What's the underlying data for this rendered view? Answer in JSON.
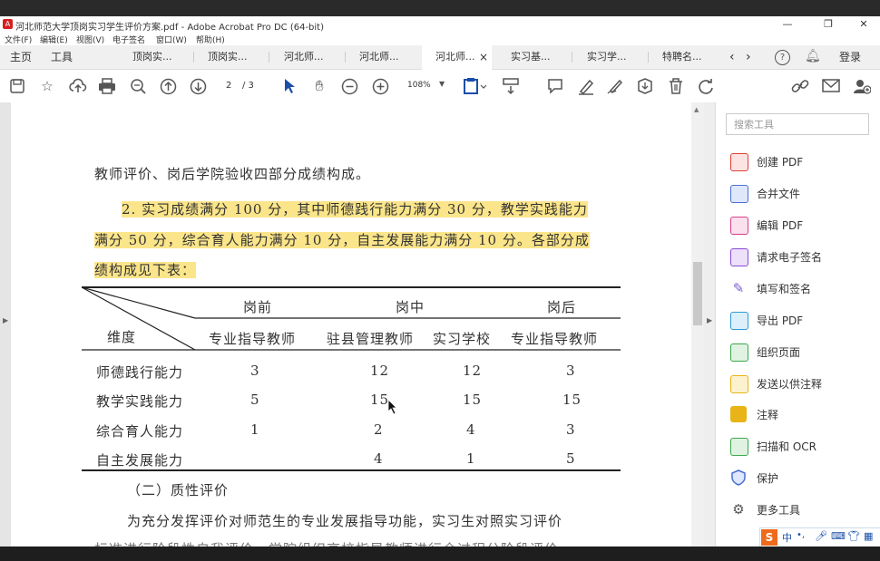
{
  "window": {
    "title": "河北师范大学顶岗实习学生评价方案.pdf - Adobe Acrobat Pro DC (64-bit)",
    "minimize": "—",
    "maximize": "❐",
    "close": "✕"
  },
  "menu": [
    "文件(F)",
    "编辑(E)",
    "视图(V)",
    "电子签名",
    "窗口(W)",
    "帮助(H)"
  ],
  "tabs": {
    "home": "主页",
    "tools": "工具",
    "items": [
      "顶岗实...",
      "顶岗实...",
      "河北师...",
      "河北师...",
      "河北师...",
      "实习基...",
      "实习学...",
      "特聘名..."
    ],
    "active_index": 4,
    "close": "×",
    "login": "登录"
  },
  "toolbar": {
    "page_current": "2",
    "page_total": "/ 3",
    "zoom": "108%"
  },
  "doc": {
    "line1": "教师评价、岗后学院验收四部分成绩构成。",
    "hl1": "2. 实习成绩满分 100 分，其中师德践行能力满分 30 分，教学实践能力",
    "hl2": "满分 50 分，综合育人能力满分 10 分，自主发展能力满分 10 分。各部分成",
    "hl3": "绩构成见下表：",
    "table": {
      "dimension": "维度",
      "groups": [
        "岗前",
        "岗中",
        "岗后"
      ],
      "subheaders": [
        "专业指导教师",
        "驻县管理教师",
        "实习学校",
        "专业指导教师"
      ],
      "rows": [
        {
          "name": "师德践行能力",
          "cells": [
            "3",
            "12",
            "12",
            "3"
          ]
        },
        {
          "name": "教学实践能力",
          "cells": [
            "5",
            "15",
            "15",
            "15"
          ]
        },
        {
          "name": "综合育人能力",
          "cells": [
            "1",
            "2",
            "4",
            "3"
          ]
        },
        {
          "name": "自主发展能力",
          "cells": [
            "",
            "4",
            "1",
            "5"
          ]
        }
      ]
    },
    "section": "（二）质性评价",
    "para": "为充分发挥评价对师范生的专业发展指导功能，实习生对照实习评价",
    "para2": "标准进行阶段性自我评价，学院组织高校指导教师进行全过程分阶段评价"
  },
  "right_panel": {
    "search_placeholder": "搜索工具",
    "tools": [
      {
        "label": "创建 PDF",
        "color": "#e0403a"
      },
      {
        "label": "合并文件",
        "color": "#4a6fd8"
      },
      {
        "label": "编辑 PDF",
        "color": "#d8408a"
      },
      {
        "label": "请求电子签名",
        "color": "#8a4ad8"
      },
      {
        "label": "填写和签名",
        "color": "#7b5bd6"
      },
      {
        "label": "导出 PDF",
        "color": "#2c9ad8"
      },
      {
        "label": "组织页面",
        "color": "#3aa84a"
      },
      {
        "label": "发送以供注释",
        "color": "#e8b417"
      },
      {
        "label": "注释",
        "color": "#e8b417"
      },
      {
        "label": "扫描和 OCR",
        "color": "#3aa84a"
      },
      {
        "label": "保护",
        "color": "#4a6fd8"
      },
      {
        "label": "更多工具",
        "color": "#555555"
      }
    ]
  },
  "ime": {
    "label": "中"
  }
}
